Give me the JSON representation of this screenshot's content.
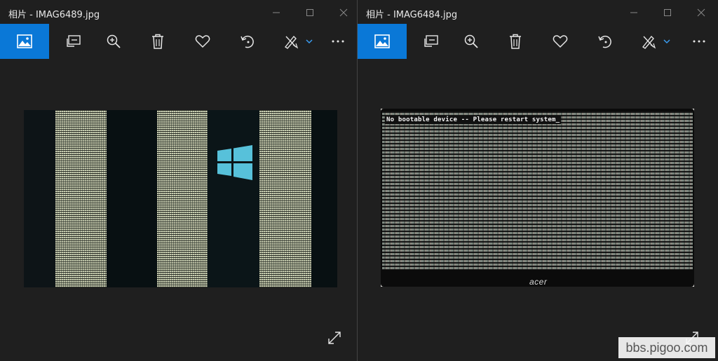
{
  "windows": [
    {
      "id": "left",
      "title": "相片 - IMAG6489.jpg"
    },
    {
      "id": "right",
      "title": "相片 - IMAG6484.jpg",
      "screen_text": "No bootable device -- Please restart system_",
      "brand_text": "acer"
    }
  ],
  "toolbar_icons": [
    "image-icon",
    "slideshow-icon",
    "zoom-in-icon",
    "delete-icon",
    "favorite-heart-icon",
    "rotate-icon",
    "edit-create-icon",
    "chevron-down-icon",
    "more-icon"
  ],
  "window_controls": [
    "minimize-icon",
    "maximize-icon",
    "close-icon"
  ],
  "colors": {
    "accent": "#0a78d7",
    "background": "#1f1f1f",
    "icon": "#e6e6e6"
  },
  "watermark": "bbs.pigoo.com"
}
